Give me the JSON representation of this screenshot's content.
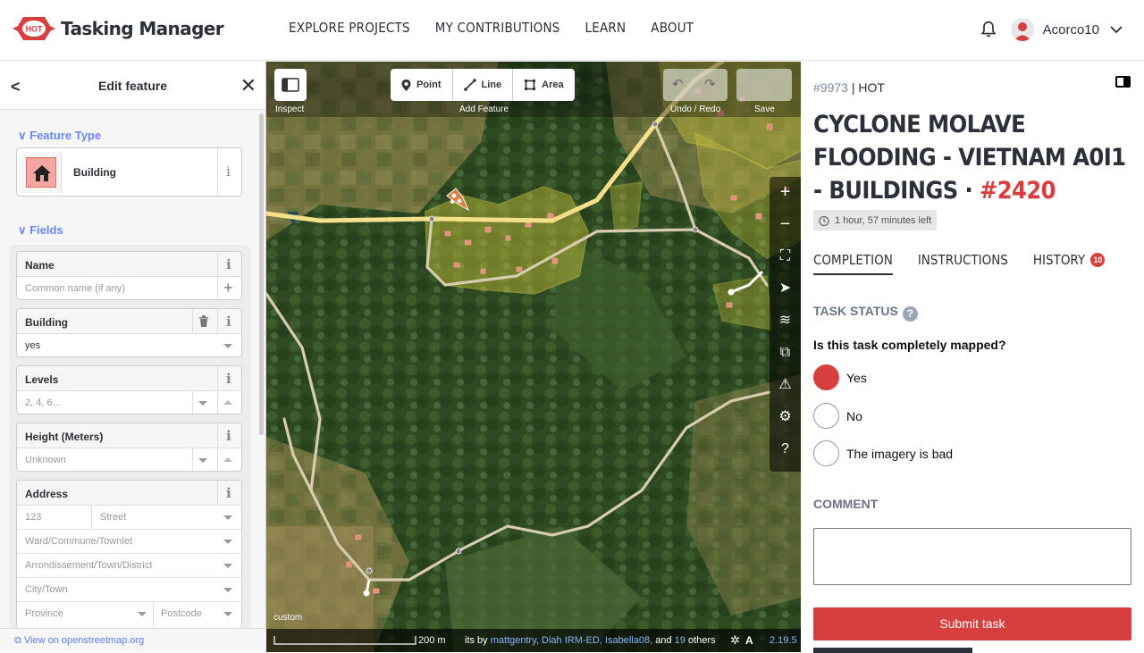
{
  "header": {
    "logo_badge": "HOT",
    "logo_text": "Tasking Manager",
    "nav": [
      "EXPLORE PROJECTS",
      "MY CONTRIBUTIONS",
      "LEARN",
      "ABOUT"
    ],
    "user_name": "Acorco10",
    "brand_color": "#d73f3f"
  },
  "editor": {
    "title": "Edit feature",
    "feature_type_label": "Feature Type",
    "feature_type": "Building",
    "fields_label": "Fields",
    "fields": {
      "name_label": "Name",
      "name_placeholder": "Common name (if any)",
      "building_label": "Building",
      "building_value": "yes",
      "levels_label": "Levels",
      "levels_placeholder": "2, 4, 6...",
      "height_label": "Height (Meters)",
      "height_placeholder": "Unknown",
      "address_label": "Address",
      "housenumber_placeholder": "123",
      "street_placeholder": "Street",
      "ward_placeholder": "Ward/Commune/Townlet",
      "district_placeholder": "Arrondissement/Town/District",
      "city_placeholder": "City/Town",
      "province_placeholder": "Province",
      "postcode_placeholder": "Postcode"
    },
    "footer_link": "View on openstreetmap.org"
  },
  "map": {
    "inspect_label": "Inspect",
    "add_feature_label": "Add Feature",
    "modes": [
      "Point",
      "Line",
      "Area"
    ],
    "undo_redo_label": "Undo / Redo",
    "save_label": "Save",
    "imagery_label": "custom",
    "scale_label": "200 m",
    "attribution_prefix": "its by",
    "attribution_users": "mattgentry, Diah IRM-ED, Isabella08,",
    "attribution_and": "and",
    "attribution_count": "19",
    "attribution_suffix": "others",
    "version": "2.19.5"
  },
  "task": {
    "project_id": "#9973",
    "organisation": "HOT",
    "title_main": "CYCLONE MOLAVE FLOODING - VIETNAM A0I1 - BUILDINGS ·",
    "task_id": "#2420",
    "time_left": "1 hour, 57 minutes left",
    "tabs": [
      "COMPLETION",
      "INSTRUCTIONS",
      "HISTORY"
    ],
    "history_count": "10",
    "status_heading": "TASK STATUS",
    "question": "Is this task completely mapped?",
    "options": [
      "Yes",
      "No",
      "The imagery is bad"
    ],
    "selected_option": "Yes",
    "comment_heading": "COMMENT",
    "submit_label": "Submit task"
  }
}
